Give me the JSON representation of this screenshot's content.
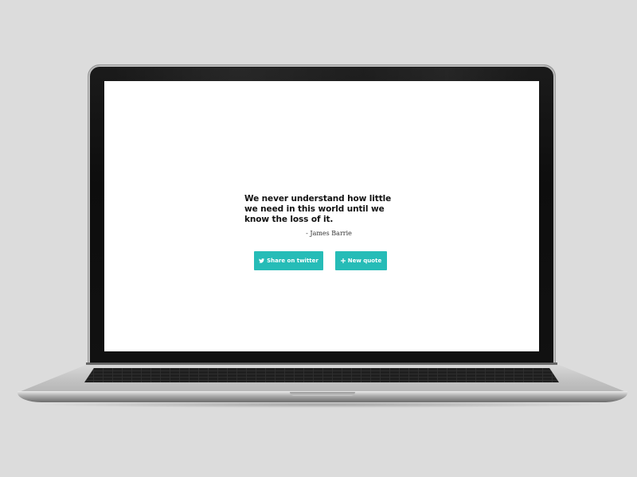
{
  "quote": {
    "text": "We never understand how little we need in this world until we know the loss of it.",
    "author": "- James Barrie"
  },
  "buttons": {
    "twitter": {
      "label": "Share on twitter",
      "icon": "twitter-bird-icon"
    },
    "new_quote": {
      "label": "New quote",
      "icon": "plus-icon"
    }
  },
  "colors": {
    "button_accent": "#26bcb7",
    "screen_background": "#ffffff",
    "page_background": "#dcdcdc",
    "quote_text": "#111111"
  }
}
